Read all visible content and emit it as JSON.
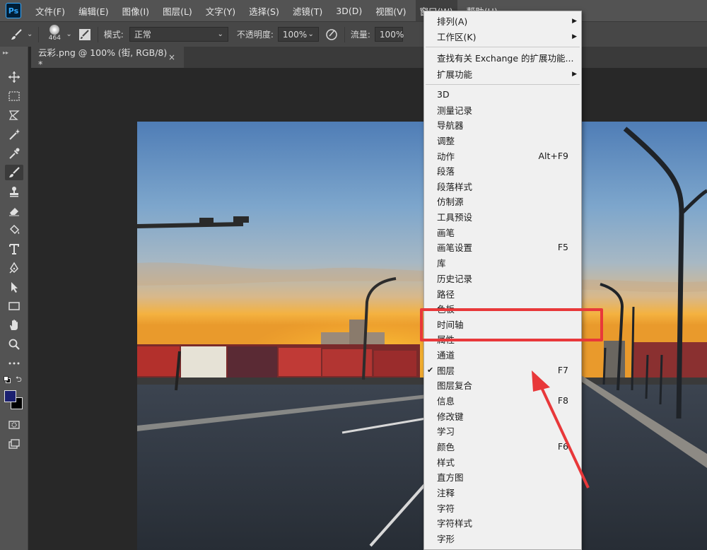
{
  "app": {
    "logo": "Ps"
  },
  "menubar": {
    "items": [
      "文件(F)",
      "编辑(E)",
      "图像(I)",
      "图层(L)",
      "文字(Y)",
      "选择(S)",
      "滤镜(T)",
      "3D(D)",
      "视图(V)",
      "窗口(W)",
      "帮助(H)"
    ],
    "active_index": 9
  },
  "options": {
    "brush_size": "464",
    "mode_label": "模式:",
    "mode_value": "正常",
    "opacity_label": "不透明度:",
    "opacity_value": "100%",
    "flow_label": "流量:",
    "flow_value": "100%"
  },
  "document": {
    "tab_title": "云彩.png @ 100% (街, RGB/8) *",
    "close_glyph": "×"
  },
  "toolbar": {
    "tools": [
      "move-icon",
      "marquee-icon",
      "lasso-icon",
      "magic-wand-icon",
      "eyedropper-icon",
      "brush-icon",
      "stamp-icon",
      "eraser-icon",
      "paint-bucket-icon",
      "type-icon",
      "pen-icon",
      "path-select-icon",
      "rectangle-icon",
      "hand-icon",
      "zoom-icon",
      "more-icon"
    ],
    "active_tool": "brush-icon",
    "foreground_color": "#1b2070",
    "background_color": "#000000"
  },
  "window_menu": {
    "items": [
      {
        "label": "排列(A)",
        "submenu": true
      },
      {
        "label": "工作区(K)",
        "submenu": true
      },
      {
        "separator": true
      },
      {
        "label": "查找有关 Exchange 的扩展功能..."
      },
      {
        "label": "扩展功能",
        "submenu": true
      },
      {
        "separator": true
      },
      {
        "label": "3D"
      },
      {
        "label": "测量记录"
      },
      {
        "label": "导航器"
      },
      {
        "label": "调整"
      },
      {
        "label": "动作",
        "shortcut": "Alt+F9"
      },
      {
        "label": "段落"
      },
      {
        "label": "段落样式"
      },
      {
        "label": "仿制源"
      },
      {
        "label": "工具预设"
      },
      {
        "label": "画笔"
      },
      {
        "label": "画笔设置",
        "shortcut": "F5"
      },
      {
        "label": "库"
      },
      {
        "label": "历史记录"
      },
      {
        "label": "路径"
      },
      {
        "label": "色板"
      },
      {
        "label": "时间轴"
      },
      {
        "label": "属性"
      },
      {
        "label": "通道"
      },
      {
        "label": "图层",
        "shortcut": "F7",
        "checked": true
      },
      {
        "label": "图层复合"
      },
      {
        "label": "信息",
        "shortcut": "F8"
      },
      {
        "label": "修改键"
      },
      {
        "label": "学习"
      },
      {
        "label": "颜色",
        "shortcut": "F6"
      },
      {
        "label": "样式"
      },
      {
        "label": "直方图"
      },
      {
        "label": "注释"
      },
      {
        "label": "字符"
      },
      {
        "label": "字符样式"
      },
      {
        "label": "字形"
      }
    ],
    "highlighted_item": "时间轴",
    "annotation_color": "#e8383a"
  }
}
